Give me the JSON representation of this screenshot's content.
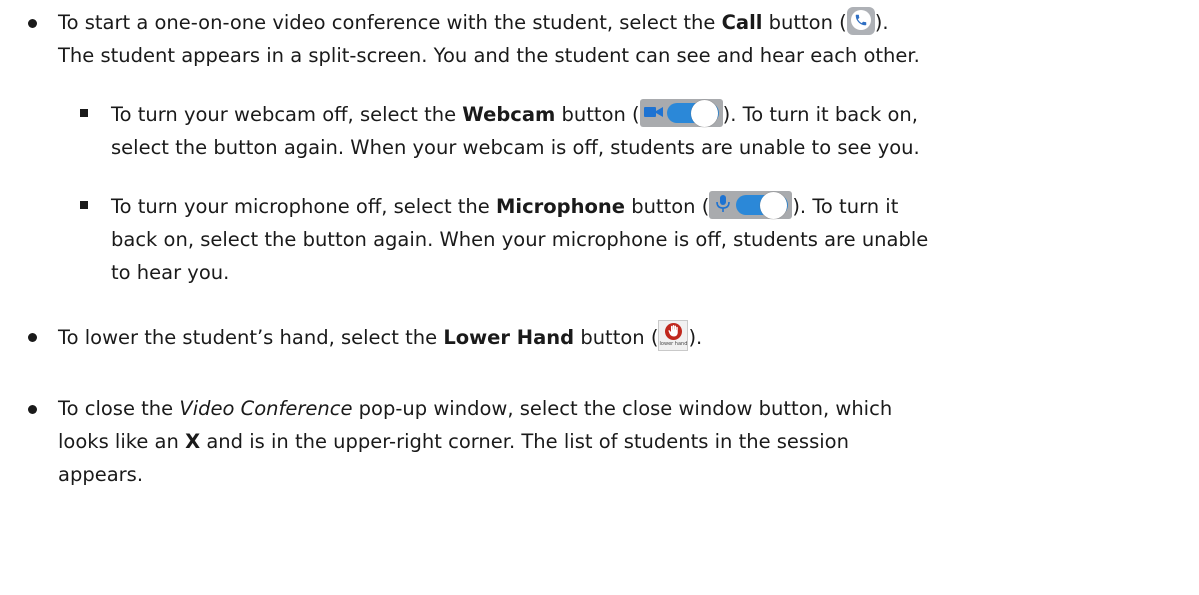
{
  "items": [
    {
      "id": "call",
      "pre": "To start a one-on-one video conference with the student, select the ",
      "bold": "Call",
      "post1": " button (",
      "post2": ").",
      "line2": "The student appears in a split-screen. You and the student can see and hear each other."
    },
    {
      "id": "webcam",
      "pre": "To turn your webcam off, select the ",
      "bold": "Webcam",
      "post1": " button (",
      "post2": "). To turn it back on,",
      "line2": "select the button again. When your webcam is off, students are unable to see you."
    },
    {
      "id": "microphone",
      "pre": "To turn your microphone off, select the ",
      "bold": "Microphone",
      "post1": " button (",
      "post2": "). To turn it",
      "line2": "back on, select the button again. When your microphone is off, students are unable",
      "line3": "to hear you."
    },
    {
      "id": "lower-hand",
      "pre": "To lower the student’s hand, select the ",
      "bold": "Lower Hand",
      "post1": " button (",
      "post2": ")."
    },
    {
      "id": "close",
      "pre": "To close the ",
      "italic": "Video Conference",
      "mid": " pop-up window, select the close window button, which",
      "line2_pre": "looks like an ",
      "line2_bold": "X",
      "line2_post": " and is in the upper-right corner. The list of students in the session",
      "line3": "appears."
    }
  ],
  "icons": {
    "call": "phone-icon",
    "webcam": "webcam-toggle-icon",
    "microphone": "microphone-toggle-icon",
    "lower_hand": "lower-hand-icon",
    "lower_hand_caption": "lower hand"
  },
  "colors": {
    "text": "#1a1a1a",
    "toggle_track": "#2b88d8",
    "icon_bg": "#a9abae",
    "phone_blue": "#2f6fc3",
    "hand_red": "#c0281e"
  }
}
